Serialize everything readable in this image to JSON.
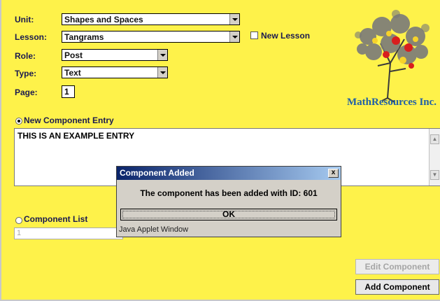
{
  "form": {
    "unit_label": "Unit:",
    "unit_value": "Shapes and Spaces",
    "lesson_label": "Lesson:",
    "lesson_value": "Tangrams",
    "new_lesson_label": "New Lesson",
    "role_label": "Role:",
    "role_value": "Post",
    "type_label": "Type:",
    "type_value": "Text",
    "page_label": "Page:",
    "page_value": "1"
  },
  "entry": {
    "radio_label": "New Component Entry",
    "text": "THIS IS AN EXAMPLE ENTRY"
  },
  "component_list": {
    "radio_label": "Component List",
    "value": "1"
  },
  "logo": {
    "text": "MathResources Inc."
  },
  "buttons": {
    "edit": "Edit Component",
    "add": "Add Component"
  },
  "dialog": {
    "title": "Component Added",
    "close": "x",
    "message": "The component has been added with ID: 601",
    "ok": "OK",
    "footer": "Java Applet Window"
  },
  "colors": {
    "background": "#fef24a",
    "title_bar": "#0a246a",
    "logo_text": "#1f5fa8"
  }
}
